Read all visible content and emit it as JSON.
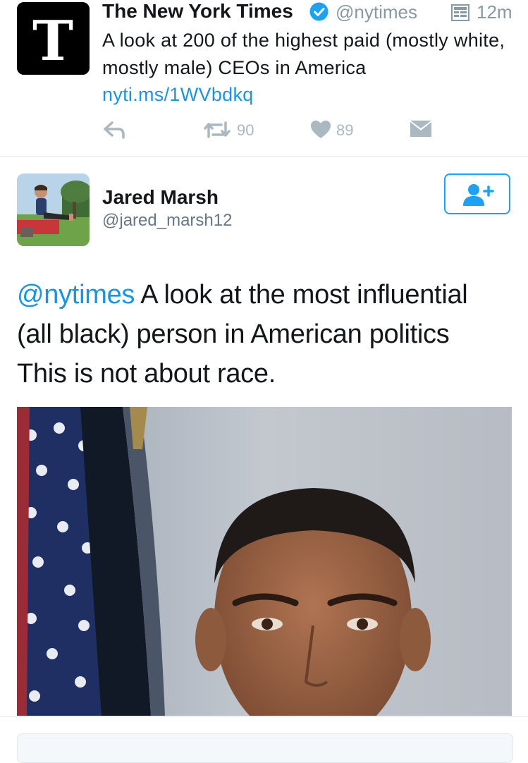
{
  "quoted_tweet": {
    "account_name": "The New York Times",
    "handle": "@nytimes",
    "time": "12m",
    "text": "A look at 200 of the highest paid (mostly white, mostly male) CEOs in America",
    "link": "nyti.ms/1WVbdkq",
    "retweets": "90",
    "likes": "89",
    "logo_letter": "T",
    "icons": [
      "verified-icon",
      "timeline-icon",
      "reply-icon",
      "retweet-icon",
      "heart-icon",
      "message-icon"
    ]
  },
  "tweet": {
    "author_name": "Jared Marsh",
    "author_handle": "@jared_marsh12",
    "mention": "@nytimes",
    "text_line1": " A look at the most influential",
    "text_line2": "(all black) person in American politics",
    "text_line3": "This is not about race.",
    "follow_icon": "add-user-icon"
  },
  "colors": {
    "accent_blue": "#1da1f2",
    "link_blue": "#1b95e0",
    "muted_gray": "#8899a6",
    "action_gray": "#aab8c2"
  }
}
